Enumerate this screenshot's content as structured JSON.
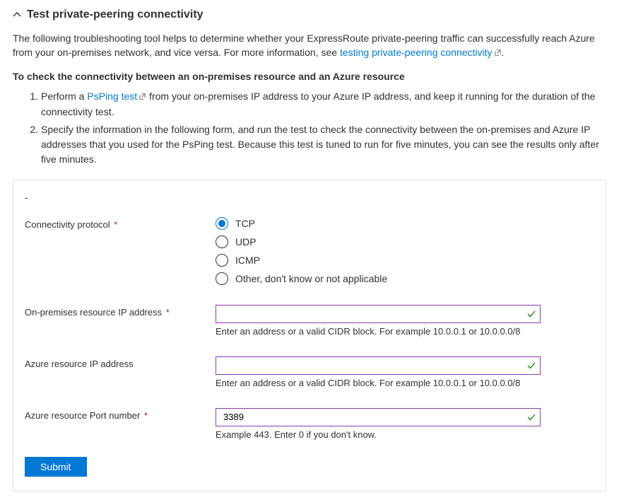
{
  "header": {
    "title": "Test private-peering connectivity"
  },
  "intro": {
    "text_before_link": "The following troubleshooting tool helps to determine whether your ExpressRoute private-peering traffic can successfully reach Azure from your on-premises network, and vice versa. For more information, see ",
    "link_text": "testing private-peering connectivity",
    "text_after_link": "."
  },
  "subheading": "To check the connectivity between an on-premises resource and an Azure resource",
  "steps": {
    "step1_before": "Perform a ",
    "step1_link": "PsPing test",
    "step1_after": " from your on-premises IP address to your Azure IP address, and keep it running for the duration of the connectivity test.",
    "step2": "Specify the information in the following form, and run the test to check the connectivity between the on-premises and Azure IP addresses that you used for the PsPing test. Because this test is tuned to run for five minutes, you can see the results only after five minutes."
  },
  "form": {
    "separator": "-",
    "protocol": {
      "label": "Connectivity protocol",
      "required_marker": "*",
      "options": [
        "TCP",
        "UDP",
        "ICMP",
        "Other, don't know or not applicable"
      ],
      "selected_index": 0
    },
    "onprem_ip": {
      "label": "On-premises resource IP address",
      "required_marker": "*",
      "value": "",
      "hint": "Enter an address or a valid CIDR block. For example 10.0.0.1 or 10.0.0.0/8"
    },
    "azure_ip": {
      "label": "Azure resource IP address",
      "required_marker": "",
      "value": "",
      "hint": "Enter an address or a valid CIDR block. For example 10.0.0.1 or 10.0.0.0/8"
    },
    "azure_port": {
      "label": "Azure resource Port number",
      "required_marker": "*",
      "value": "3389",
      "hint": "Example 443. Enter 0 if you don't know."
    },
    "submit_label": "Submit"
  }
}
